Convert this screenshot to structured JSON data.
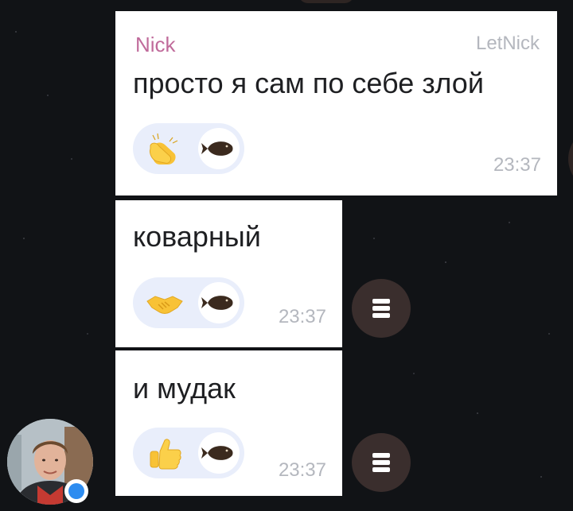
{
  "messages": [
    {
      "sender": "Nick",
      "tag": "LetNick",
      "text": "просто я сам по себе злой",
      "time": "23:37",
      "reaction": "clapping-hands"
    },
    {
      "text": "коварный",
      "time": "23:37",
      "reaction": "handshake"
    },
    {
      "text": "и мудак",
      "time": "23:37",
      "reaction": "thumbs-up"
    }
  ],
  "colors": {
    "background": "#111316",
    "bubble": "#ffffff",
    "sender": "#c06b9b",
    "meta": "#b4b7be",
    "reaction_pill": "#e9eefb",
    "menu_button": "#3a2e2d",
    "online": "#2d8cf0"
  },
  "icons": {
    "menu": "hamburger-menu-icon",
    "reactor_avatar": "flounder-fish-icon"
  }
}
